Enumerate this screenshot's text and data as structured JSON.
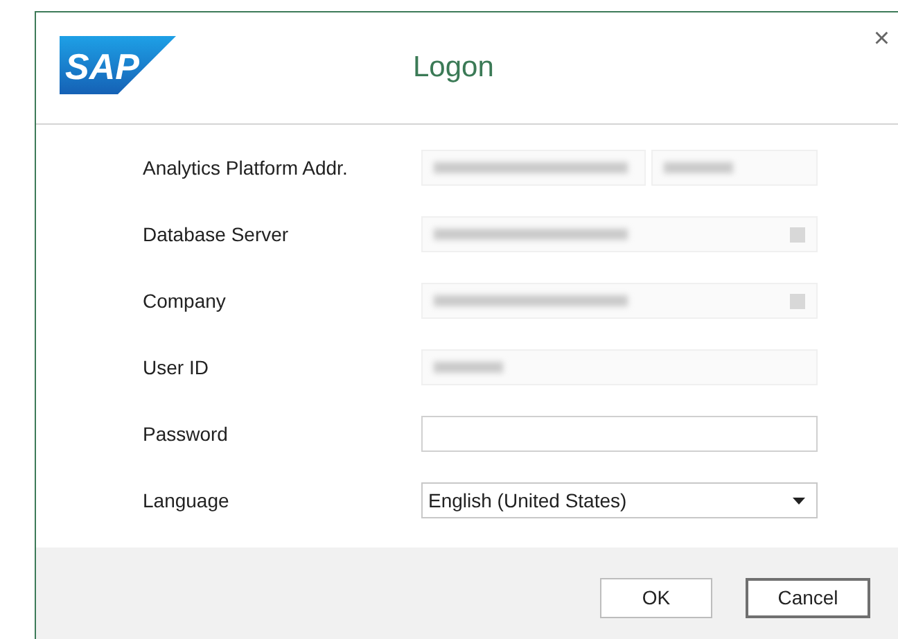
{
  "dialog": {
    "logo": "SAP",
    "title": "Logon",
    "close": "×"
  },
  "fields": [
    {
      "label": "Analytics Platform Addr.",
      "kind": "split",
      "blurred": true
    },
    {
      "label": "Database Server",
      "kind": "combo",
      "blurred": true
    },
    {
      "label": "Company",
      "kind": "combo",
      "blurred": true
    },
    {
      "label": "User ID",
      "kind": "text",
      "blurred": true
    },
    {
      "label": "Password",
      "kind": "password",
      "blurred": false
    },
    {
      "label": "Language",
      "kind": "select",
      "blurred": false,
      "value": "English (United States)"
    }
  ],
  "buttons": [
    {
      "label": "OK",
      "default": false
    },
    {
      "label": "Cancel",
      "default": true
    }
  ]
}
